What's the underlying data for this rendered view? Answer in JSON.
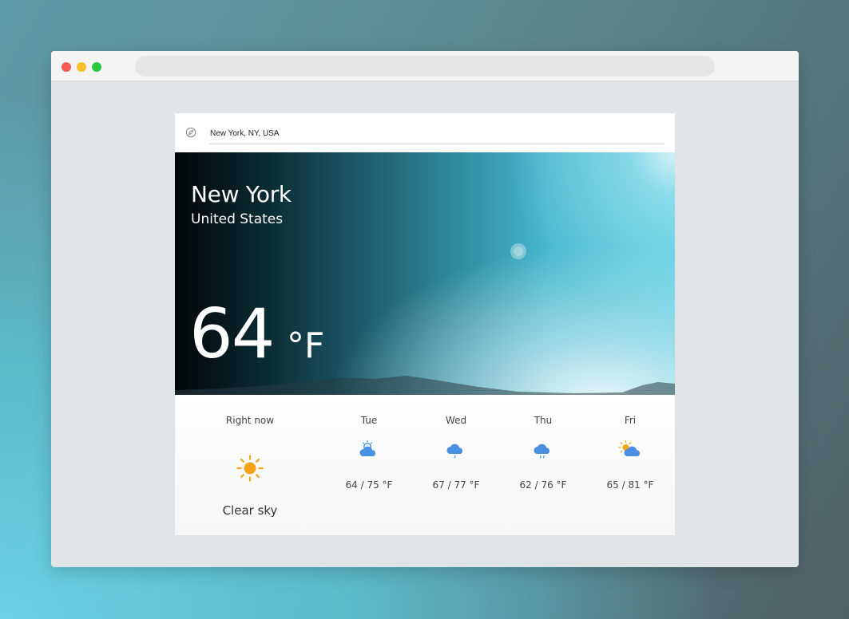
{
  "browser": {
    "traffic_lights": [
      "#f35d55",
      "#f6bf2e",
      "#2bc840"
    ]
  },
  "search": {
    "icon": "compass-icon",
    "value": "New York, NY, USA"
  },
  "hero": {
    "city": "New York",
    "country": "United States",
    "temperature": "64",
    "unit": "°F"
  },
  "current": {
    "label": "Right now",
    "icon": "sun-icon",
    "condition": "Clear sky"
  },
  "forecast": [
    {
      "day": "Tue",
      "icon": "cloud-sun-icon",
      "temps": "64 / 75 °F"
    },
    {
      "day": "Wed",
      "icon": "cloud-rain-icon",
      "temps": "67 / 77 °F"
    },
    {
      "day": "Thu",
      "icon": "cloud-rain-icon",
      "temps": "62 / 76 °F"
    },
    {
      "day": "Fri",
      "icon": "sun-cloud-icon",
      "temps": "65 / 81 °F"
    }
  ],
  "colors": {
    "sun": "#f5a31a",
    "cloud": "#4a90e2"
  }
}
